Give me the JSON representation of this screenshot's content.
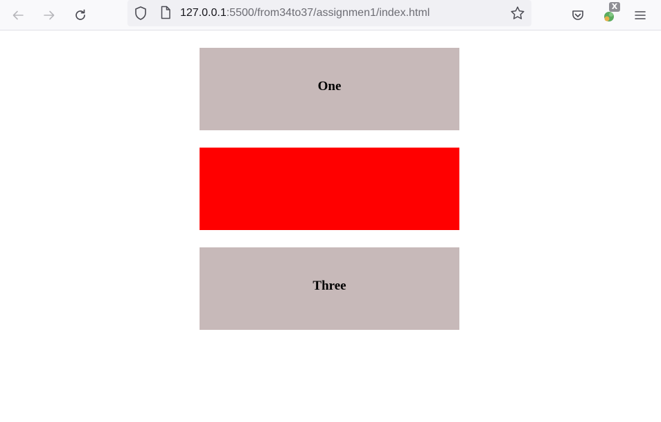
{
  "browser": {
    "url_host": "127.0.0.1",
    "url_rest": ":5500/from34to37/assignmen1/index.html",
    "extension_badge": "X"
  },
  "boxes": [
    {
      "label": "One",
      "color": "#c7b9b9"
    },
    {
      "label": "",
      "color": "#ff0000"
    },
    {
      "label": "Three",
      "color": "#c7b9b9"
    }
  ]
}
